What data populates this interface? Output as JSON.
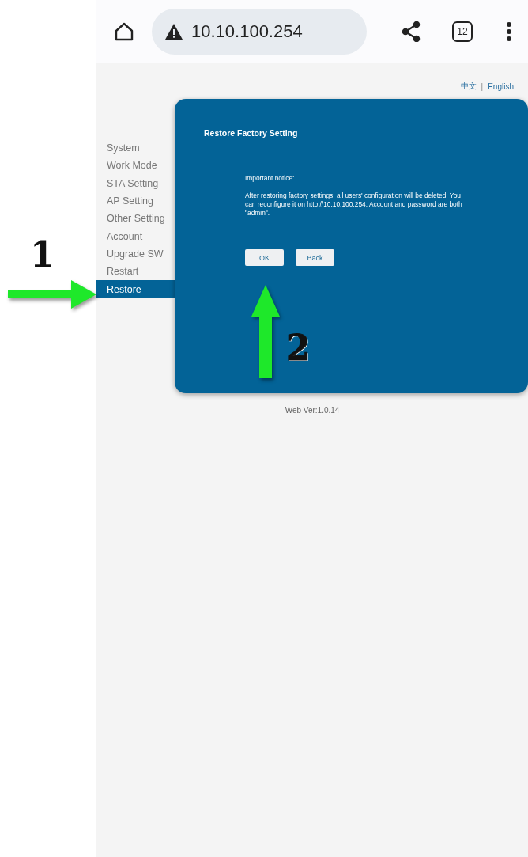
{
  "browser": {
    "url": "10.10.100.254",
    "tab_count": "12"
  },
  "languages": {
    "items": [
      "中文",
      "English"
    ],
    "separator": "|"
  },
  "sidebar": {
    "items": [
      {
        "label": "System",
        "selected": false
      },
      {
        "label": "Work Mode",
        "selected": false
      },
      {
        "label": "STA Setting",
        "selected": false
      },
      {
        "label": "AP Setting",
        "selected": false
      },
      {
        "label": "Other Setting",
        "selected": false
      },
      {
        "label": "Account",
        "selected": false
      },
      {
        "label": "Upgrade SW",
        "selected": false
      },
      {
        "label": "Restart",
        "selected": false
      },
      {
        "label": "Restore",
        "selected": true
      }
    ]
  },
  "panel": {
    "title": "Restore Factory Setting",
    "notice_heading": "Important notice:",
    "notice": "After restoring factory settings, all users' configuration will be deleted. You can reconfigure it on http://10.10.100.254. Account and password are both \"admin\".",
    "buttons": [
      "OK",
      "Back"
    ]
  },
  "footer": "Web Ver:1.0.14",
  "annotations": [
    {
      "label": "1",
      "kind": "right"
    },
    {
      "label": "2",
      "kind": "up"
    }
  ]
}
